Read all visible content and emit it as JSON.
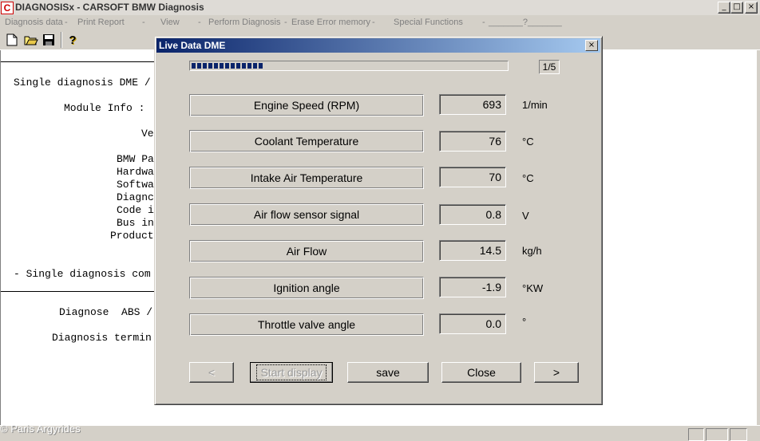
{
  "window": {
    "app_icon": "C",
    "title": "DIAGNOSISx - CARSOFT BMW Diagnosis",
    "minimize": "_",
    "maximize": "□",
    "close": "×"
  },
  "menubar": {
    "items": [
      "Diagnosis data",
      "Print Report",
      "View",
      "Perform Diagnosis",
      "Erase Error memory",
      "Special Functions",
      "_______?_______"
    ],
    "separator": "-"
  },
  "toolbar": {
    "icons": [
      "new-document-icon",
      "open-folder-icon",
      "save-disk-icon",
      "help-icon"
    ],
    "help_glyph": "?"
  },
  "document": {
    "lines": [
      "Single diagnosis DME /",
      "Module Info :",
      "Ve",
      "BMW Pa",
      "Hardwa",
      "Softwa",
      "Diagnc",
      "Code i",
      "Bus in",
      "Product",
      "- Single diagnosis com",
      "Diagnose  ABS /",
      "Diagnosis termin"
    ]
  },
  "status": {
    "copyright": "© Paris Argyrides"
  },
  "dialog": {
    "title": "Live Data DME",
    "close": "×",
    "progress_fraction": 0.23,
    "page_indicator": "1/5",
    "rows": [
      {
        "label": "Engine Speed (RPM)",
        "value": "693",
        "unit": "1/min"
      },
      {
        "label": "Coolant Temperature",
        "value": "76",
        "unit": "°C"
      },
      {
        "label": "Intake Air Temperature",
        "value": "70",
        "unit": "°C"
      },
      {
        "label": "Air flow sensor signal",
        "value": "0.8",
        "unit": "V"
      },
      {
        "label": "Air Flow",
        "value": "14.5",
        "unit": "kg/h"
      },
      {
        "label": "Ignition angle",
        "value": "-1.9",
        "unit": "°KW"
      },
      {
        "label": "Throttle valve angle",
        "value": "0.0",
        "unit": "°"
      }
    ],
    "buttons": {
      "prev": "<",
      "start_display": "Start display",
      "save": "save",
      "close": "Close",
      "next": ">"
    }
  }
}
